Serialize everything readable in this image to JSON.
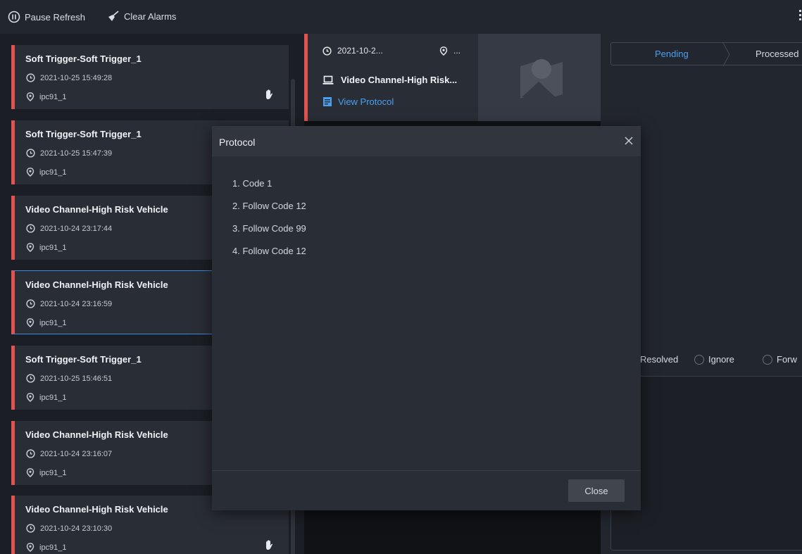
{
  "toolbar": {
    "pause_label": "Pause Refresh",
    "clear_label": "Clear Alarms"
  },
  "alarms": [
    {
      "title": "Soft Trigger-Soft Trigger_1",
      "time": "2021-10-25 15:49:28",
      "location": "ipc91_1",
      "handled_icon": true
    },
    {
      "title": "Soft Trigger-Soft Trigger_1",
      "time": "2021-10-25 15:47:39",
      "location": "ipc91_1",
      "handled_icon": false
    },
    {
      "title": "Video Channel-High Risk Vehicle",
      "time": "2021-10-24 23:17:44",
      "location": "ipc91_1",
      "handled_icon": false
    },
    {
      "title": "Video Channel-High Risk Vehicle",
      "time": "2021-10-24 23:16:59",
      "location": "ipc91_1",
      "handled_icon": false,
      "selected": true
    },
    {
      "title": "Soft Trigger-Soft Trigger_1",
      "time": "2021-10-25 15:46:51",
      "location": "ipc91_1",
      "handled_icon": false
    },
    {
      "title": "Video Channel-High Risk Vehicle",
      "time": "2021-10-24 23:16:07",
      "location": "ipc91_1",
      "handled_icon": false
    },
    {
      "title": "Video Channel-High Risk Vehicle",
      "time": "2021-10-24 23:10:30",
      "location": "ipc91_1",
      "handled_icon": true
    }
  ],
  "detail": {
    "time": "2021-10-2...",
    "location": "...",
    "channel": "Video Channel-High Risk...",
    "view_protocol": "View Protocol"
  },
  "right": {
    "tab_pending": "Pending",
    "tab_processed": "Processed",
    "options": [
      "Resolved",
      "Ignore",
      "Forw"
    ]
  },
  "modal": {
    "title": "Protocol",
    "items": [
      "1. Code 1",
      "2. Follow Code 12",
      "3. Follow Code 99",
      "4. Follow Code 12"
    ],
    "close_label": "Close"
  },
  "colors": {
    "accent": "#4aa0f0",
    "alarm_red": "#e2534f",
    "selected_border": "#3c8ae0"
  }
}
